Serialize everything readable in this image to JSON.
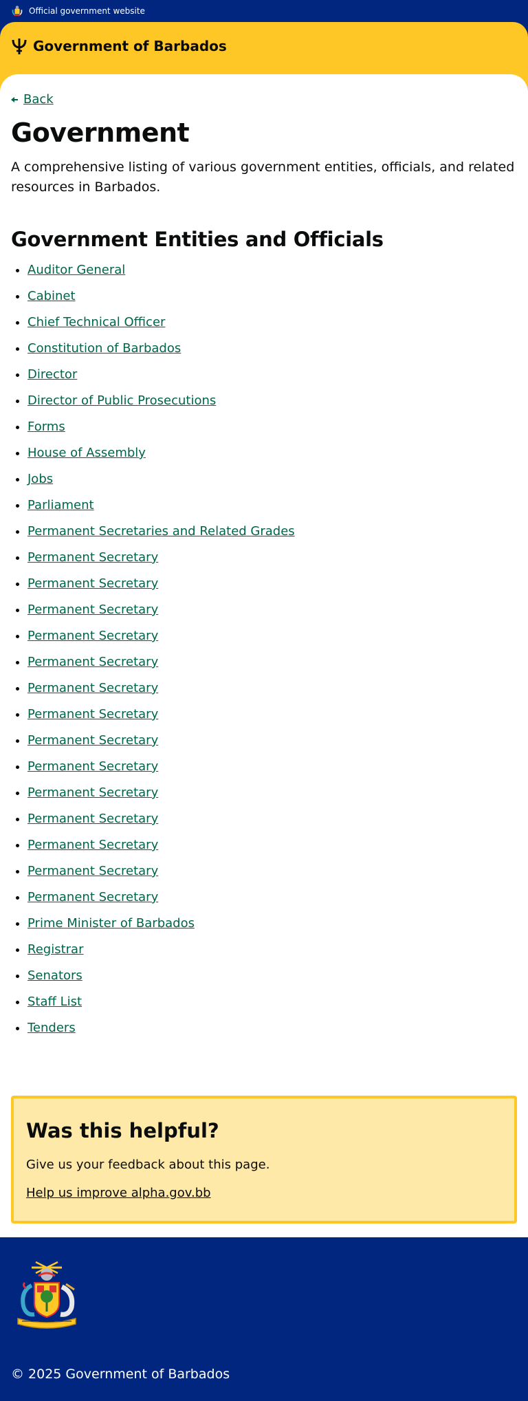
{
  "topbar": {
    "crest_icon": "coat-of-arms-icon",
    "text": "Official government website"
  },
  "header": {
    "trident_icon": "trident-icon",
    "brand": "Government of Barbados"
  },
  "nav": {
    "back_label": "Back"
  },
  "page": {
    "title": "Government",
    "lead": "A comprehensive listing of various government entities, officials, and related resources in Barbados."
  },
  "entities": {
    "heading": "Government Entities and Officials",
    "items": [
      "Auditor General",
      "Cabinet",
      "Chief Technical Officer",
      "Constitution of Barbados",
      "Director",
      "Director of Public Prosecutions",
      "Forms",
      "House of Assembly",
      "Jobs",
      "Parliament",
      "Permanent Secretaries and Related Grades",
      "Permanent Secretary",
      "Permanent Secretary",
      "Permanent Secretary",
      "Permanent Secretary",
      "Permanent Secretary",
      "Permanent Secretary",
      "Permanent Secretary",
      "Permanent Secretary",
      "Permanent Secretary",
      "Permanent Secretary",
      "Permanent Secretary",
      "Permanent Secretary",
      "Permanent Secretary",
      "Permanent Secretary",
      "Prime Minister of Barbados",
      "Registrar",
      "Senators",
      "Staff List",
      "Tenders"
    ]
  },
  "feedback": {
    "heading": "Was this helpful?",
    "text": "Give us your feedback about this page.",
    "link": "Help us improve alpha.gov.bb"
  },
  "footer": {
    "copyright": "© 2025 Government of Barbados"
  },
  "colors": {
    "navy": "#00267f",
    "gold": "#ffc726",
    "link_green": "#00654a",
    "feedback_bg": "#ffe9a8"
  }
}
